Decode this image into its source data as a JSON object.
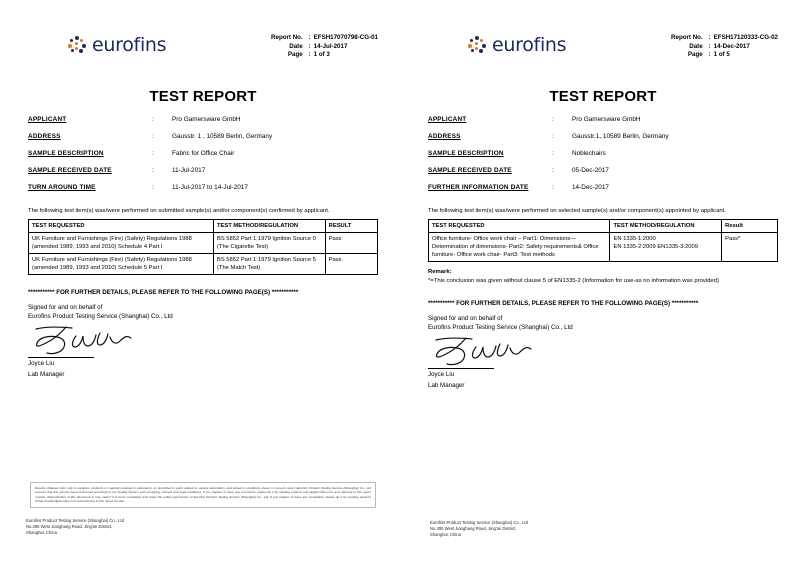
{
  "documents": [
    {
      "id": "left-report",
      "logo": {
        "brand": "eurofins",
        "mark_icon": "eurofins-dots-logo-icon",
        "brand_color": "#1b2a56",
        "accent_color": "#e8731e"
      },
      "meta": {
        "report_no_label": "Report No.",
        "report_no_value": "EFSH17070798-CG-01",
        "date_label": "Date",
        "date_value": "14-Jul-2017",
        "page_label": "Page",
        "page_value": "1 of 3"
      },
      "title": "TEST REPORT",
      "fields": [
        {
          "label": "APPLICANT",
          "value": "Pro Gamersware GmbH"
        },
        {
          "label": "ADDRESS",
          "value": "Gausstr. 1 , 10589 Berlin, Germany"
        },
        {
          "label": "SAMPLE DESCRIPTION",
          "value": "Fabric for Office Chair"
        },
        {
          "label": "SAMPLE RECEIVED DATE",
          "value": "11-Jul-2017"
        },
        {
          "label": "TURN AROUND TIME",
          "value": "11-Jul-2017 to 14-Jul-2017"
        }
      ],
      "intro": "The following test item(s) was/were performed on submitted sample(s) and/or component(s) confirmed by applicant.",
      "table": {
        "headers": [
          "TEST REQUESTED",
          "TEST METHOD/REGULATION",
          "RESULT"
        ],
        "rows": [
          {
            "requested": "UK Furniture and Furnishings (Fire) (Safety) Regulations 1988 (amended 1989, 1993 and 2010) Schedule 4 Part I",
            "method": "BS 5852 Part 1:1979 Ignition Source 0 (The Cigarette Test)",
            "result": "Pass"
          },
          {
            "requested": "UK Furniture and Furnishings (Fire) (Safety) Regulations 1988 (amended 1989, 1993 and 2010) Schedule 5 Part I",
            "method": "BS 5852 Part 1:1979 Ignition Source 5 (The Match Test)",
            "result": "Pass"
          }
        ]
      },
      "remark": null,
      "further_details": "*********** FOR FURTHER DETAILS, PLEASE REFER TO THE FOLLOWING PAGE(S) ***********",
      "signed_for": "Signed for and on behalf of",
      "signed_company": "Eurofins Product Testing Service (Shanghai) Co., Ltd",
      "signer_name": "Joyce Liu",
      "signer_title": "Lab Manager",
      "disclaimer": "Results obtained refer only to samples, products or material received in Laboratory, as described in point related to sample description, and tested in conditions shown in present report. Eurofins Product Testing Service (Shanghai) Co., Ltd ensures that this job has been performed according to our Quality System and complying contract and legal conditions. If you happen to have any comments, please do it by sending email to info.uk@eurofins.com and referring to this report number. Reproduction of this document is only valid if it is done completely and under the written permission of Eurofins Product Testing Service (Shanghai) Co., Ltd. If you happen to have any complaints, please do it by sending email to chinacomplaint@eurofins.com and referring to this report number.",
      "disclaimer_links": [
        "info.uk@eurofins.com",
        "chinacomplaint@eurofins.com"
      ],
      "footer_address": [
        "Eurofins Product Testing Service (Shanghai) Co., Ltd",
        "No.395 West Jianghang Road, Jing'an District,",
        "Shanghai, China"
      ]
    },
    {
      "id": "right-report",
      "logo": {
        "brand": "eurofins",
        "mark_icon": "eurofins-dots-logo-icon",
        "brand_color": "#1b2a56",
        "accent_color": "#e8731e"
      },
      "meta": {
        "report_no_label": "Report No.",
        "report_no_value": "EFSH17120333-CG-02",
        "date_label": "Date",
        "date_value": "14-Dec-2017",
        "page_label": "Page",
        "page_value": "1 of 5"
      },
      "title": "TEST REPORT",
      "fields": [
        {
          "label": "APPLICANT",
          "value": "Pro Gamersware GmbH"
        },
        {
          "label": "ADDRESS",
          "value": "Gausstr.1, 10589 Berlin, Germany"
        },
        {
          "label": "SAMPLE DESCRIPTION",
          "value": "Noblechairs"
        },
        {
          "label": "SAMPLE RECEIVED DATE",
          "value": "05-Dec-2017"
        },
        {
          "label": "FURTHER INFORMATION DATE",
          "value": "14-Dec-2017"
        }
      ],
      "intro": "The following test item(s) was/were performed on selected sample(s) and/or component(s) appointed by applicant.",
      "table": {
        "headers": [
          "TEST REQUESTED",
          "TEST METHOD/REGULATION",
          "Result"
        ],
        "rows": [
          {
            "requested": "Office furniture- Office work chair – Part1: Dimensions— Determination of dimensions- Part2: Safety requirements& Office furniture- Office work chair- Part3: Test methods",
            "method": "EN 1335-1:2000\nEN 1335-2:2009 EN1335-3:2009",
            "result": "Pass*"
          }
        ]
      },
      "remark": {
        "title": "Remark:",
        "text": "*=This conclusion was given without clause 5 of EN1335-2 (Information for use-as no information was provided)"
      },
      "further_details": "*********** FOR FURTHER DETAILS, PLEASE REFER TO THE FOLLOWING PAGE(S) ***********",
      "signed_for": "Signed for and on behalf of",
      "signed_company": "Eurofins Product Testing Service (Shanghai) Co., Ltd",
      "signer_name": "Joyce Liu",
      "signer_title": "Lab Manager",
      "disclaimer": "",
      "disclaimer_links": [],
      "footer_address": [
        "Eurofins Product Testing Service (Shanghai) Co., Ltd",
        "No.395 West Jianghang Road, Jing'an District,",
        "Shanghai, China"
      ]
    }
  ]
}
